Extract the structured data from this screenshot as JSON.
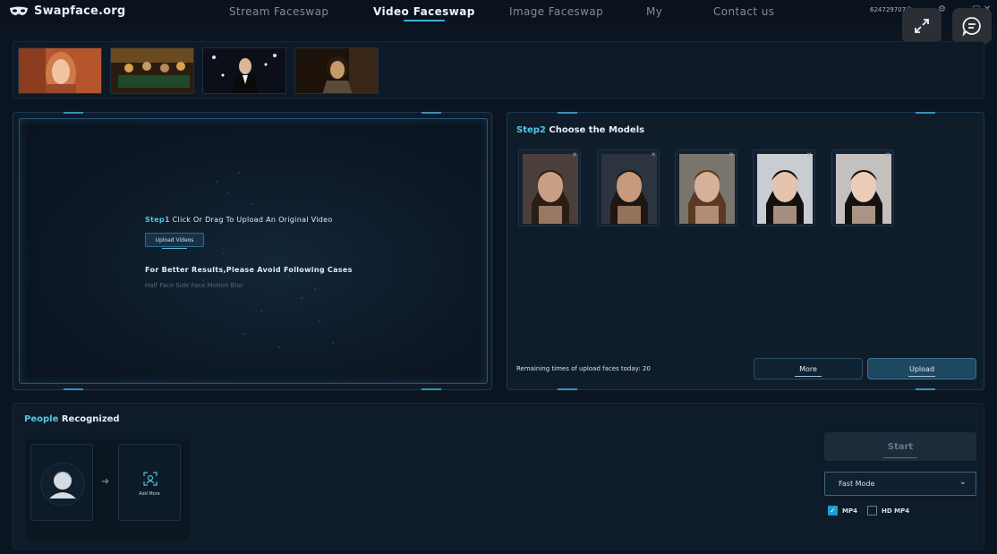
{
  "app": {
    "brand": "Swapface.org",
    "nav": [
      "Stream Faceswap",
      "Video Faceswap",
      "Image Faceswap",
      "My",
      "Contact us"
    ],
    "active_nav": "Video Faceswap",
    "user_email": "624729707@qq.com",
    "window_controls": {
      "settings": "⚙",
      "minimize": "–",
      "maximize": "□",
      "close": "✕"
    }
  },
  "thumbnails": [
    {
      "name": "woman-red-hair",
      "colors": [
        "#c2653b",
        "#8c3c1f",
        "#f3c8a0"
      ]
    },
    {
      "name": "casino-scene",
      "colors": [
        "#6b4a22",
        "#2a1d10",
        "#d7a24a"
      ]
    },
    {
      "name": "man-tuxedo-party",
      "colors": [
        "#1a2236",
        "#0c0f17",
        "#6d88a6"
      ]
    },
    {
      "name": "woman-bob-hair",
      "colors": [
        "#3a2616",
        "#1c120a",
        "#c79a6a"
      ]
    }
  ],
  "step1": {
    "step_label": "Step1",
    "text": " Click Or Drag To Upload An Original Video",
    "upload_button": "Upload Videos",
    "better_results": "For Better Results,Please Avoid Following Cases",
    "cases": "Half Face Side Face Motion Blur"
  },
  "step2": {
    "step_label": "Step2",
    "title": " Choose the Models",
    "models": [
      {
        "name": "model-man-long-hair",
        "hair": "#2a1d15",
        "skin": "#c89f83",
        "bg": "#4a3f3a"
      },
      {
        "name": "model-man-short-hair",
        "hair": "#1d1612",
        "skin": "#c79a7c",
        "bg": "#2c3440"
      },
      {
        "name": "model-woman-brown-hair",
        "hair": "#5a3a24",
        "skin": "#d7b09a",
        "bg": "#7a756c"
      },
      {
        "name": "model-man-suit",
        "hair": "#111111",
        "skin": "#e5c3ad",
        "bg": "#c9ccd0"
      },
      {
        "name": "model-woman-black-hair",
        "hair": "#121212",
        "skin": "#eccbb7",
        "bg": "#c4c0bd"
      }
    ],
    "close_glyph": "✕",
    "remaining": "Remaining times of upload faces today: 20",
    "more_button": "More",
    "upload_button": "Upload"
  },
  "people": {
    "title_highlight": "People",
    "title_rest": " Recognized",
    "arrow": "➜",
    "add_more": "Add More"
  },
  "controls": {
    "start_button": "Start",
    "mode": "Fast Mode",
    "checkboxes": [
      {
        "label": "MP4",
        "checked": true
      },
      {
        "label": "HD MP4",
        "checked": false
      }
    ]
  },
  "accent": "#3fb0d8"
}
